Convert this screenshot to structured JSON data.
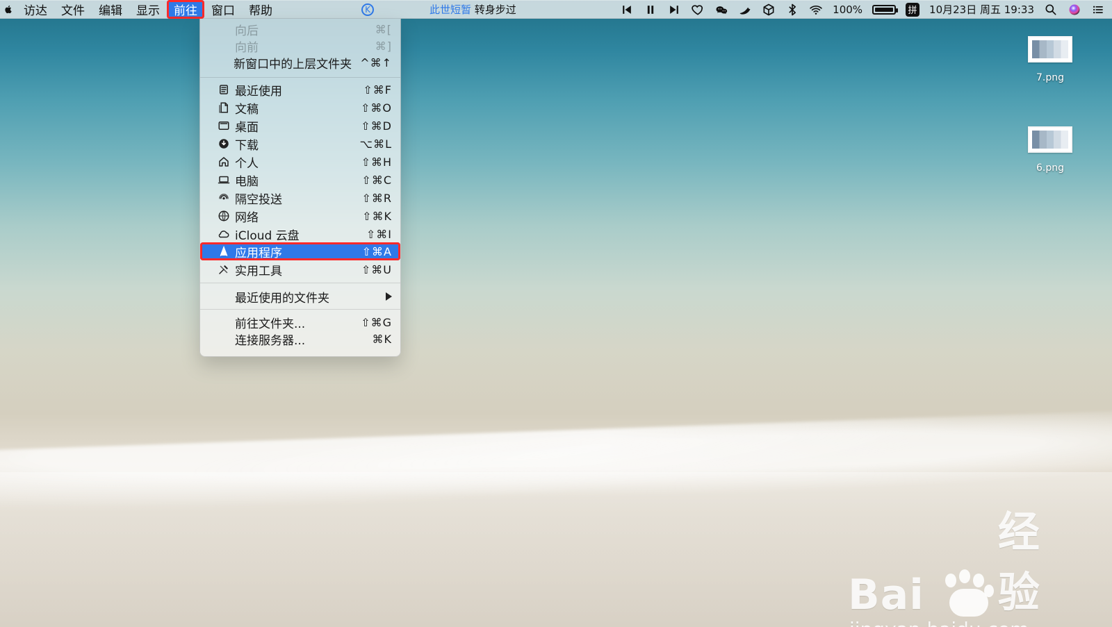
{
  "menubar": {
    "apple": "apple",
    "items": [
      "访达",
      "文件",
      "编辑",
      "显示",
      "前往",
      "窗口",
      "帮助"
    ],
    "active_index": 4,
    "center_k": "K",
    "song_prefix": "此世短暂",
    "song_suffix": "转身步过",
    "battery_percent": "100%",
    "input_method": "拼",
    "datetime": "10月23日 周五 19:33"
  },
  "menu": {
    "items": [
      {
        "label": "向后",
        "shortcut": "⌘[",
        "disabled": true
      },
      {
        "label": "向前",
        "shortcut": "⌘]",
        "disabled": true
      },
      {
        "label": "新窗口中的上层文件夹",
        "shortcut": "^⌘↑",
        "disabled": false
      },
      {
        "label": "最近使用",
        "shortcut": "⇧⌘F",
        "icon": "recent-icon"
      },
      {
        "label": "文稿",
        "shortcut": "⇧⌘O",
        "icon": "documents-icon"
      },
      {
        "label": "桌面",
        "shortcut": "⇧⌘D",
        "icon": "desktop-icon"
      },
      {
        "label": "下载",
        "shortcut": "⌥⌘L",
        "icon": "downloads-icon"
      },
      {
        "label": "个人",
        "shortcut": "⇧⌘H",
        "icon": "home-icon"
      },
      {
        "label": "电脑",
        "shortcut": "⇧⌘C",
        "icon": "computer-icon"
      },
      {
        "label": "隔空投送",
        "shortcut": "⇧⌘R",
        "icon": "airdrop-icon"
      },
      {
        "label": "网络",
        "shortcut": "⇧⌘K",
        "icon": "network-icon"
      },
      {
        "label": "iCloud 云盘",
        "shortcut": "⇧⌘I",
        "icon": "icloud-icon"
      },
      {
        "label": "应用程序",
        "shortcut": "⇧⌘A",
        "icon": "applications-icon",
        "highlight": true
      },
      {
        "label": "实用工具",
        "shortcut": "⇧⌘U",
        "icon": "utilities-icon"
      },
      {
        "label": "最近使用的文件夹",
        "submenu": true
      },
      {
        "label": "前往文件夹...",
        "shortcut": "⇧⌘G"
      },
      {
        "label": "连接服务器...",
        "shortcut": "⌘K"
      }
    ]
  },
  "desktop": {
    "files": [
      {
        "name": "7.png"
      },
      {
        "name": "6.png"
      }
    ]
  },
  "watermark": {
    "brand": "Bai",
    "brand2": "经验",
    "url": "jingyan.baidu.com"
  },
  "colors": {
    "highlight": "#2f79e8",
    "annotation_red": "#ff2a2a"
  }
}
